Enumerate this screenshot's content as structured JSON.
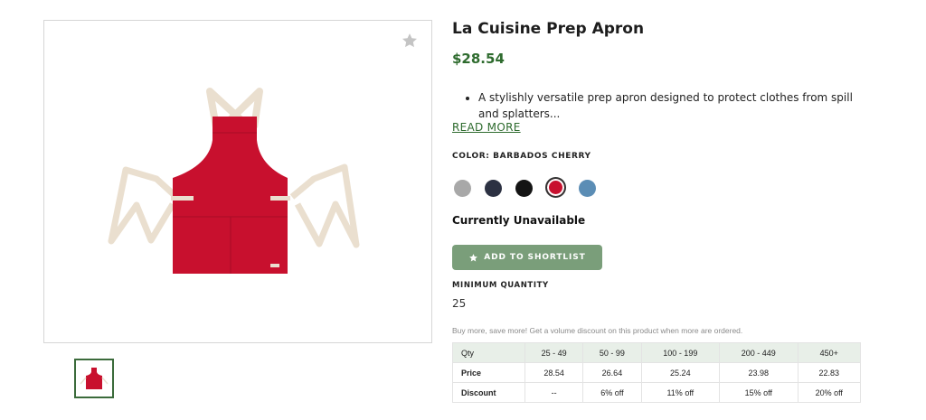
{
  "product": {
    "title": "La Cuisine Prep Apron",
    "price": "$28.54",
    "description": "A stylishly versatile prep apron designed to protect clothes from spill and splatters...",
    "read_more": "READ MORE"
  },
  "color": {
    "label": "COLOR: BARBADOS CHERRY",
    "swatches": [
      {
        "name": "gray",
        "hex": "#a8a8a8",
        "selected": false
      },
      {
        "name": "navy",
        "hex": "#2c3142",
        "selected": false
      },
      {
        "name": "black",
        "hex": "#141414",
        "selected": false
      },
      {
        "name": "barbados-cherry",
        "hex": "#c8102e",
        "selected": true
      },
      {
        "name": "blue",
        "hex": "#5b8db5",
        "selected": false
      }
    ]
  },
  "availability": "Currently Unavailable",
  "shortlist": {
    "label": "ADD TO SHORTLIST",
    "icon": "star-icon",
    "color": "#7a9e7a"
  },
  "minimum": {
    "label": "MINIMUM QUANTITY",
    "value": "25"
  },
  "volume_note": "Buy more, save more! Get a volume discount on this product when more are ordered.",
  "pricing_table": {
    "rows": [
      [
        "Qty",
        "25 - 49",
        "50 - 99",
        "100 - 199",
        "200 - 449",
        "450+"
      ],
      [
        "Price",
        "28.54",
        "26.64",
        "25.24",
        "23.98",
        "22.83"
      ],
      [
        "Discount",
        "--",
        "6% off",
        "11% off",
        "15% off",
        "20% off"
      ]
    ]
  },
  "gallery": {
    "favorite_icon": "star-icon",
    "product_color": "#c8102e",
    "strap_color": "#eadfcf"
  },
  "colors": {
    "accent_green": "#2e6b2e",
    "header_row_bg": "#e8efe8"
  }
}
